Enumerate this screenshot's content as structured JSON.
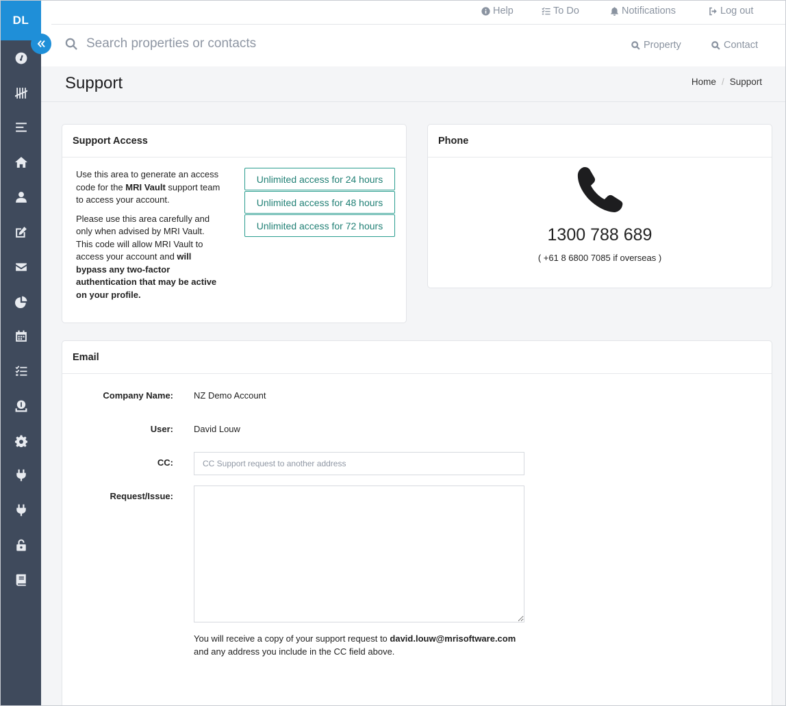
{
  "user_initials": "DL",
  "topnav": {
    "help": "Help",
    "todo": "To Do",
    "notifications": "Notifications",
    "logout": "Log out"
  },
  "search": {
    "placeholder": "Search properties or contacts",
    "property_label": "Property",
    "contact_label": "Contact"
  },
  "page": {
    "title": "Support",
    "breadcrumb": [
      "Home",
      "Support"
    ]
  },
  "sidebar_icons": [
    "dashboard-icon",
    "tally-icon",
    "menu-icon",
    "home-icon",
    "user-icon",
    "edit-icon",
    "mail-icon",
    "pie-chart-icon",
    "calendar-icon",
    "tasks-icon",
    "finance-icon",
    "gear-icon",
    "plug-icon",
    "plug-icon",
    "lock-icon",
    "book-icon"
  ],
  "support_access": {
    "title": "Support Access",
    "intro_pre": "Use this area to generate an access code for the ",
    "intro_brand": "MRI Vault",
    "intro_post": " support team to access your account.",
    "warn_pre": "Please use this area carefully and only when advised by MRI Vault. This code will allow MRI Vault to access your account and ",
    "warn_bold": "will bypass any two-factor authentication that may be active on your profile.",
    "buttons": [
      "Unlimited access for 24 hours",
      "Unlimited access for 48 hours",
      "Unlimited access for 72 hours"
    ]
  },
  "phone": {
    "title": "Phone",
    "number": "1300 788 689",
    "overseas": "( +61 8 6800 7085 if overseas )"
  },
  "email": {
    "title": "Email",
    "company_label": "Company Name:",
    "company_value": "NZ Demo Account",
    "user_label": "User:",
    "user_value": "David Louw",
    "cc_label": "CC:",
    "cc_placeholder": "CC Support request to another address",
    "cc_value": "",
    "request_label": "Request/Issue:",
    "request_value": "",
    "note_pre": "You will receive a copy of your support request to ",
    "note_email": "david.louw@mrisoftware.com",
    "note_post": " and any address you include in the CC field above."
  },
  "colors": {
    "sidebar": "#3f4a5c",
    "accent": "#1f8fd8",
    "button_border": "#2a9d8f"
  }
}
